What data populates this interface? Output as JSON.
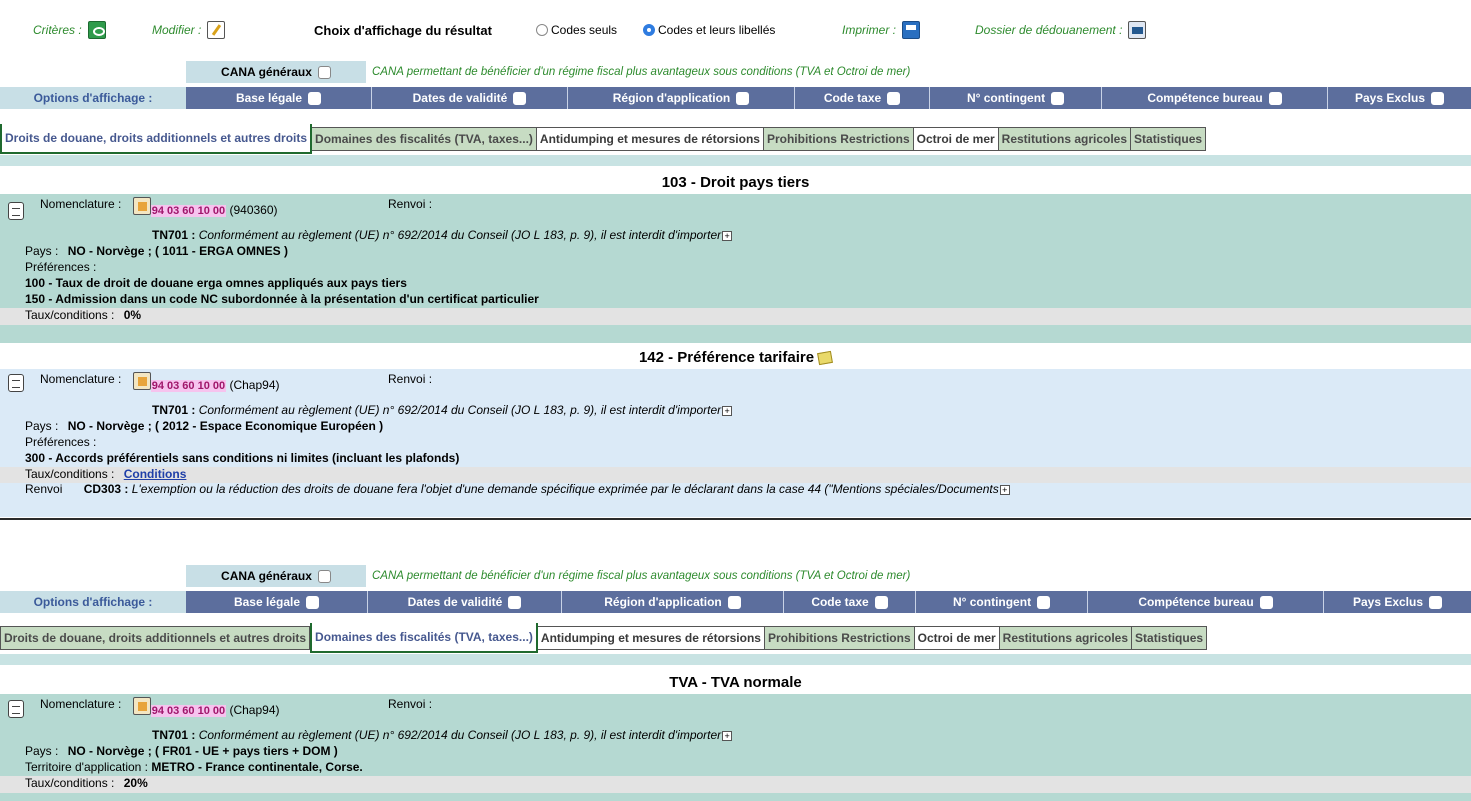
{
  "toolbar": {
    "criteres_label": "Critères :",
    "modifier_label": "Modifier :",
    "choix_label": "Choix d'affichage du résultat",
    "radio_codes_seuls": "Codes seuls",
    "radio_codes_libelles": "Codes et leurs libellés",
    "imprimer_label": "Imprimer :",
    "dossier_label": "Dossier de dédouanement :"
  },
  "options": {
    "cana_label": "CANA généraux",
    "cana_desc": "CANA permettant de bénéficier d'un régime fiscal plus avantageux sous conditions (TVA et Octroi de mer)",
    "options_label": "Options d'affichage :",
    "items": [
      "Base légale",
      "Dates de validité",
      "Région d'application",
      "Code taxe",
      "N° contingent",
      "Compétence bureau",
      "Pays Exclus"
    ]
  },
  "tabs": [
    "Droits de douane, droits additionnels et autres droits",
    "Domaines des fiscalités (TVA, taxes...)",
    "Antidumping et mesures de rétorsions",
    "Prohibitions Restrictions",
    "Octroi de mer",
    "Restitutions agricoles",
    "Statistiques"
  ],
  "common": {
    "nomenclature_label": "Nomenclature :",
    "renvoi_label": "Renvoi :",
    "pays_label": "Pays :",
    "preferences_label": "Préférences :",
    "taux_label": "Taux/conditions :",
    "code": "94 03 60 10 00",
    "tn_code": "TN701 :",
    "tn_text": "Conformément au règlement (UE) n° 692/2014 du Conseil (JO L 183, p. 9), il est interdit d'importer",
    "plus": "+"
  },
  "block1": {
    "title": "103 - Droit pays tiers",
    "code_suffix": "(940360)",
    "pays": "NO - Norvège ; ( 1011 - ERGA OMNES )",
    "pref1": "100 - Taux de droit de douane erga omnes appliqués aux pays tiers",
    "pref2": "150 - Admission dans un code NC subordonnée à la présentation d'un certificat particulier",
    "taux": "0%"
  },
  "block2": {
    "title": "142 - Préférence tarifaire",
    "code_suffix": "(Chap94)",
    "pays": "NO - Norvège ; ( 2012 - Espace Economique Européen )",
    "pref1": "300 - Accords préférentiels sans conditions ni limites (incluant les plafonds)",
    "taux_link": "Conditions",
    "renvoi_row_label": "Renvoi",
    "renvoi_code": "CD303 :",
    "renvoi_text": "L'exemption ou la réduction des droits de douane fera l'objet d'une demande spécifique exprimée par le déclarant dans la case 44 (\"Mentions spéciales/Documents"
  },
  "block3": {
    "title": "TVA - TVA normale",
    "code_suffix": "(Chap94)",
    "pays": "NO - Norvège ; ( FR01 - UE + pays tiers + DOM )",
    "territoire_label": "Territoire d'application :",
    "territoire": "METRO - France continentale, Corse.",
    "taux": "20%"
  }
}
